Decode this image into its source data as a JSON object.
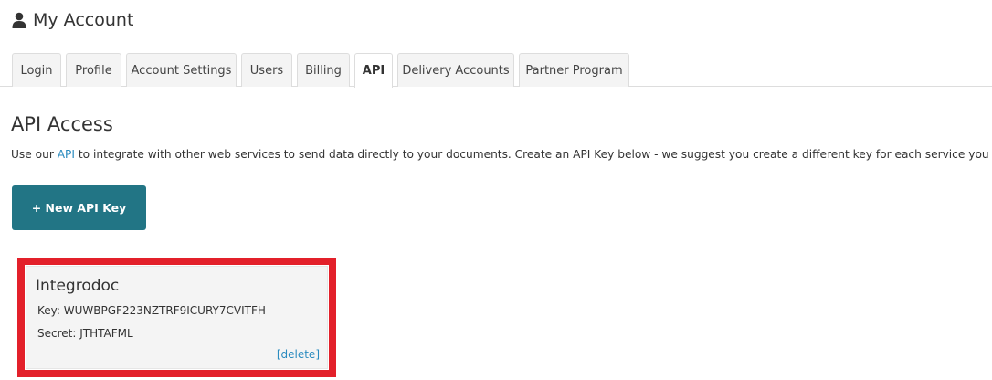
{
  "header": {
    "title": "My Account",
    "icon": "user-icon"
  },
  "tabs": [
    {
      "label": "Login",
      "active": false
    },
    {
      "label": "Profile",
      "active": false
    },
    {
      "label": "Account Settings",
      "active": false
    },
    {
      "label": "Users",
      "active": false
    },
    {
      "label": "Billing",
      "active": false
    },
    {
      "label": "API",
      "active": true
    },
    {
      "label": "Delivery Accounts",
      "active": false
    },
    {
      "label": "Partner Program",
      "active": false
    }
  ],
  "api": {
    "title": "API Access",
    "description_before": "Use our ",
    "description_link": "API",
    "description_after": " to integrate with other web services to send data directly to your documents. Create an API Key below - we suggest you create a different key for each service you use.",
    "new_key_label": "+ New API Key",
    "keys": [
      {
        "name": "Integrodoc",
        "key_label": "Key:",
        "key": "WUWBPGF223NZTRF9ICURY7CVITFH",
        "secret_label": "Secret:",
        "secret": "JTHTAFML",
        "delete_label": "[delete]"
      }
    ]
  },
  "colors": {
    "accent_button": "#227585",
    "link": "#2a8bbf",
    "highlight": "#e3202a"
  }
}
